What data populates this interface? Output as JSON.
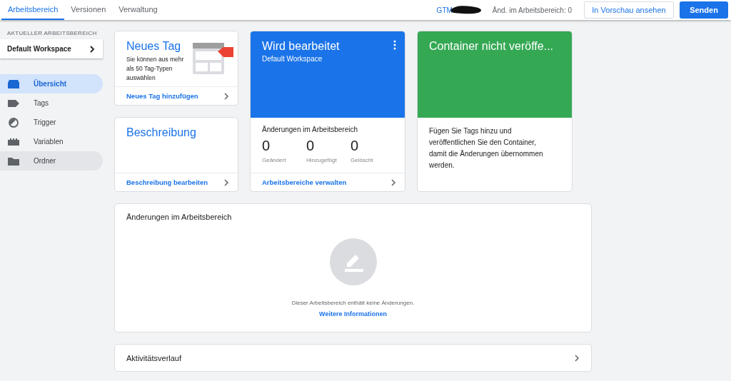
{
  "top_tabs": [
    {
      "label": "Arbeitsbereich",
      "selected": true
    },
    {
      "label": "Versionen",
      "selected": false
    },
    {
      "label": "Verwaltung",
      "selected": false
    }
  ],
  "container_id": "GTM",
  "workspace_changes": "Änd. im Arbeitsbereich: 0",
  "preview_button": "In Vorschau ansehen",
  "submit_button": "Senden",
  "sidebar": {
    "heading": "AKTUELLER ARBEITSBEREICH",
    "workspace": "Default Workspace",
    "items": [
      {
        "label": "Übersicht",
        "selected": true,
        "hovered": false
      },
      {
        "label": "Tags",
        "selected": false,
        "hovered": false
      },
      {
        "label": "Trigger",
        "selected": false,
        "hovered": false
      },
      {
        "label": "Variablen",
        "selected": false,
        "hovered": false
      },
      {
        "label": "Ordner",
        "selected": false,
        "hovered": true
      }
    ]
  },
  "new_tag_card": {
    "title": "Neues Tag",
    "text": "Sie können aus mehr als 50 Tag-Typen auswählen",
    "link": "Neues Tag hinzufügen"
  },
  "description_card": {
    "title": "Beschreibung",
    "link": "Beschreibung bearbeiten"
  },
  "editing_card": {
    "title": "Wird bearbeitet",
    "subtitle": "Default Workspace",
    "changes_heading": "Änderungen im Arbeitsbereich",
    "stats": [
      {
        "value": "0",
        "label": "Geändert"
      },
      {
        "value": "0",
        "label": "Hinzugefügt"
      },
      {
        "value": "0",
        "label": "Gelöscht"
      }
    ],
    "link": "Arbeitsbereiche verwalten"
  },
  "publish_card": {
    "title": "Container nicht veröffe...",
    "text": "Fügen Sie Tags hinzu und veröffentlichen Sie den Container, damit die Änderungen übernommen werden."
  },
  "changes_panel": {
    "title": "Änderungen im Arbeitsbereich",
    "empty_text": "Dieser Arbeitsbereich enthält keine Änderungen.",
    "link": "Weitere Informationen"
  },
  "activity_panel": {
    "title": "Aktivitätsverlauf"
  }
}
